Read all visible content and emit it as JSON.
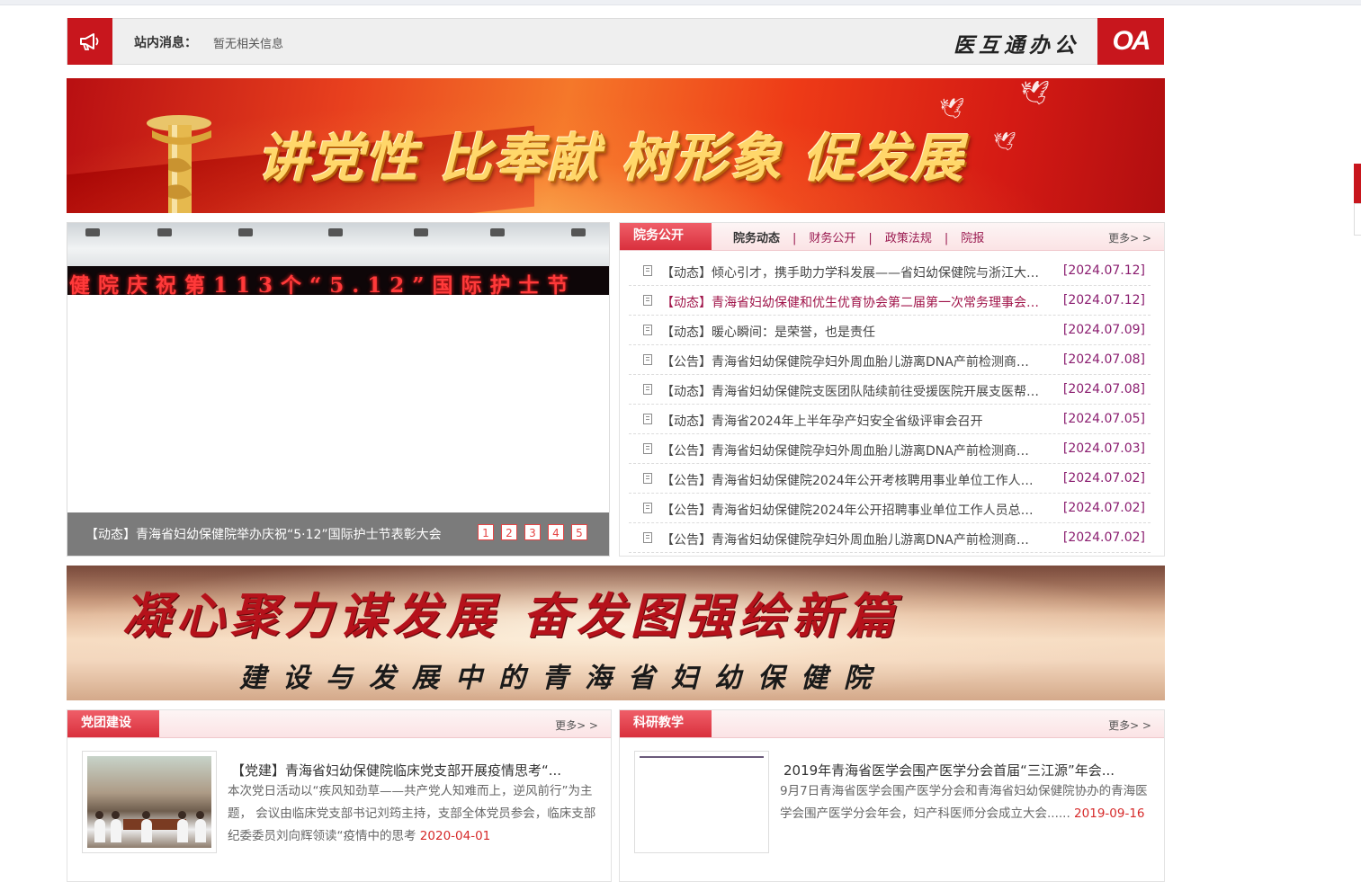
{
  "notice": {
    "label": "站内消息：",
    "message": "暂无相关信息",
    "oa_text": "医互通办公",
    "oa_logo": "OA",
    "accent": "#c8161d"
  },
  "banner1": {
    "slogan": "讲党性 比奉献 树形象 促发展"
  },
  "banner2": {
    "line1": "凝心聚力谋发展 奋发图强绘新篇",
    "line2": "建设与发展中的青海省妇幼保健院"
  },
  "slider": {
    "led_text": "健院庆祝第113个“5.12”国际护士节",
    "caption": "【动态】青海省妇幼保健院举办庆祝“5·12”国际护士节表彰大会",
    "pages": [
      "1",
      "2",
      "3",
      "4",
      "5"
    ]
  },
  "news": {
    "tab": "院务公开",
    "subtabs": [
      "院务动态",
      "财务公开",
      "政策法规",
      "院报"
    ],
    "more": "更多> >",
    "items": [
      {
        "title": "【动态】倾心引才，携手助力学科发展——省妇幼保健院与浙江大学医学院附属妇产科医院",
        "date": "[2024.07.12]",
        "highlight": false
      },
      {
        "title": "【动态】青海省妇幼保健和优生优育协会第二届第一次常务理事会议召开",
        "date": "[2024.07.12]",
        "highlight": true
      },
      {
        "title": "【动态】暖心瞬间：是荣誉，也是责任",
        "date": "[2024.07.09]",
        "highlight": false
      },
      {
        "title": "【公告】青海省妇幼保健院孕妇外周血胎儿游离DNA产前检测商业保险采购项目",
        "date": "[2024.07.08]",
        "highlight": false
      },
      {
        "title": "【动态】青海省妇幼保健院支医团队陆续前往受援医院开展支医帮扶工作",
        "date": "[2024.07.08]",
        "highlight": false
      },
      {
        "title": "【动态】青海省2024年上半年孕产妇安全省级评审会召开",
        "date": "[2024.07.05]",
        "highlight": false
      },
      {
        "title": "【公告】青海省妇幼保健院孕妇外周血胎儿游离DNA产前检测商业保险采购项目",
        "date": "[2024.07.03]",
        "highlight": false
      },
      {
        "title": "【公告】青海省妇幼保健院2024年公开考核聘用事业单位工作人员公告",
        "date": "[2024.07.02]",
        "highlight": false
      },
      {
        "title": "【公告】青海省妇幼保健院2024年公开招聘事业单位工作人员总成绩公示",
        "date": "[2024.07.02]",
        "highlight": false
      },
      {
        "title": "【公告】青海省妇幼保健院孕妇外周血胎儿游离DNA产前检测商业保险采购项目",
        "date": "[2024.07.02]",
        "highlight": false
      }
    ]
  },
  "party": {
    "tab": "党团建设",
    "more": "更多> >",
    "title": "【党建】青海省妇幼保健院临床党支部开展疫情思考“...",
    "body": "本次党日活动以“疾风知劲草——共产党人知难而上，逆风前行”为主题， 会议由临床党支部书记刘筠主持，支部全体党员参会，临床支部纪委委员刘向辉领读“疫情中的思考 ",
    "date": "2020-04-01"
  },
  "research": {
    "tab": "科研教学",
    "more": "更多> >",
    "title": "2019年青海省医学会围产医学分会首届“三江源”年会...",
    "body": "9月7日青海省医学会围产医学分会和青海省妇幼保健院协办的青海医学会围产医学分会年会，妇产科医师分会成立大会......",
    "date": "2019-09-16"
  }
}
